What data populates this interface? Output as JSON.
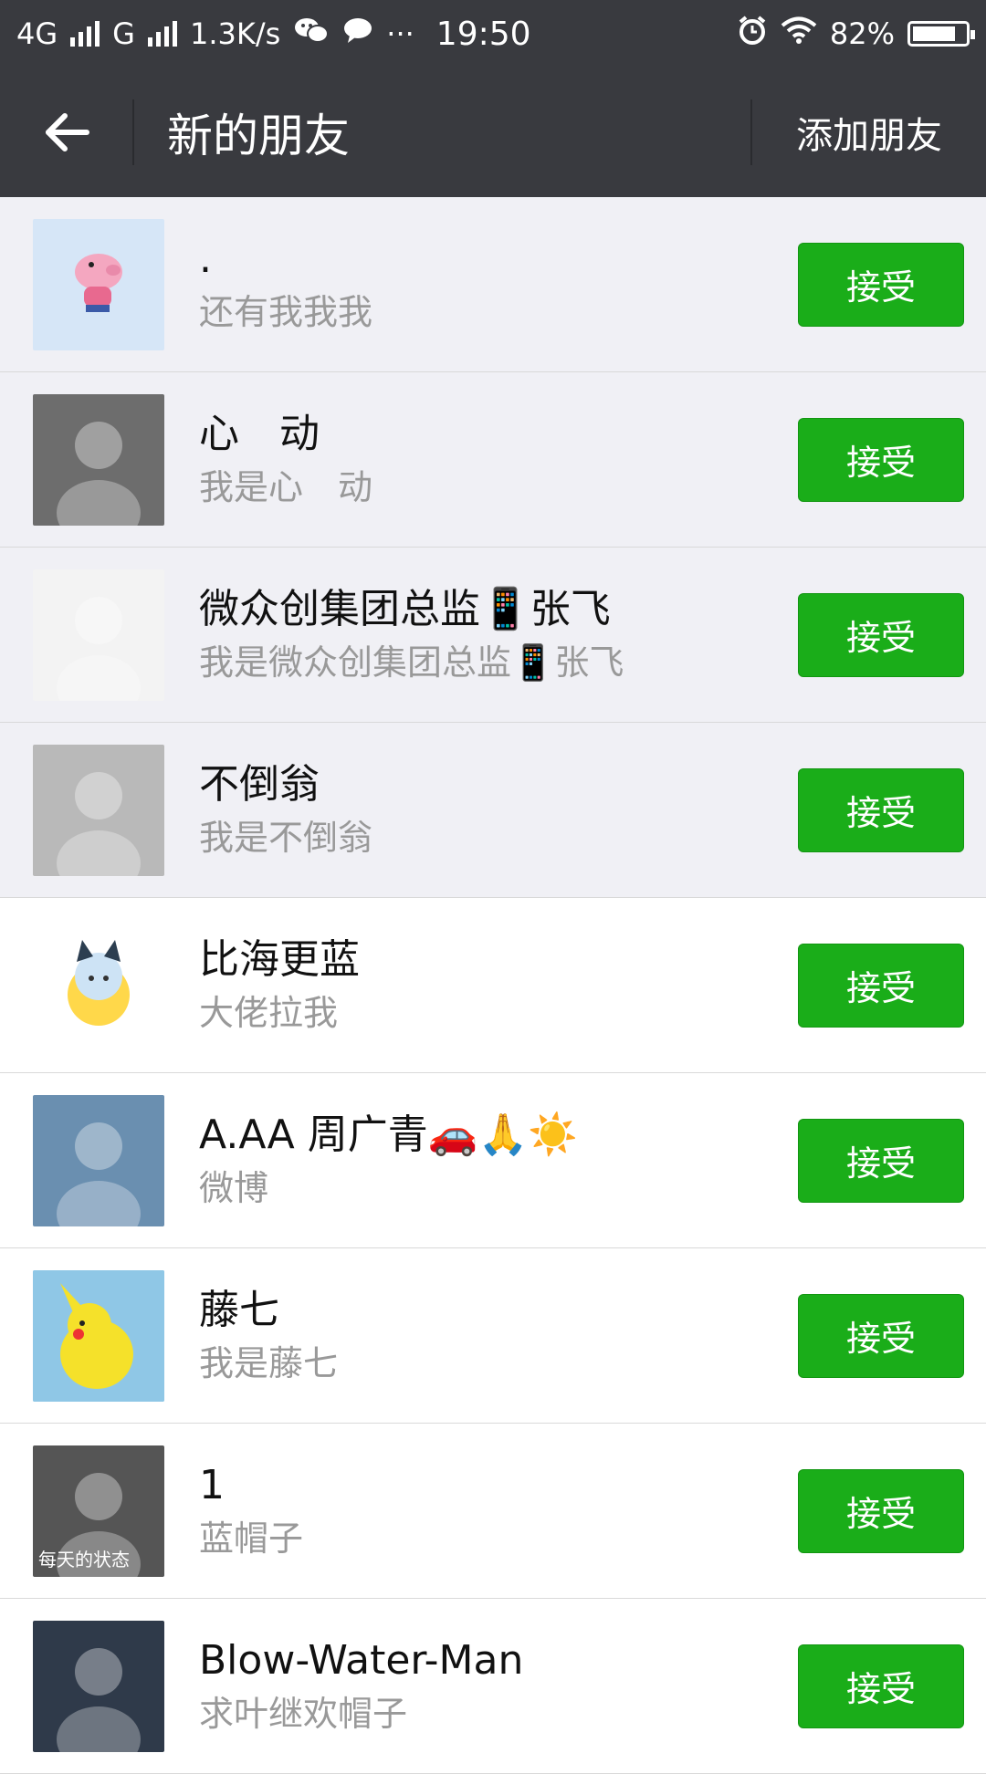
{
  "status_bar": {
    "network1": "4G",
    "network2": "G",
    "speed": "1.3K/s",
    "dots": "···",
    "time": "19:50",
    "battery_text": "82%",
    "battery_level": 0.82
  },
  "nav": {
    "title": "新的朋友",
    "add_friend_label": "添加朋友"
  },
  "requests": [
    {
      "name": ".",
      "message": "还有我我我",
      "accept_label": "接受",
      "avatar_color": "#d6e6f7",
      "avatar_icon": "pig-icon",
      "unread": true
    },
    {
      "name": "心　动",
      "message": "我是心　动",
      "accept_label": "接受",
      "avatar_color": "#6d6d6d",
      "avatar_icon": "person-photo",
      "unread": true
    },
    {
      "name": "微众创集团总监📱张飞",
      "message": "我是微众创集团总监📱张飞",
      "accept_label": "接受",
      "avatar_color": "#f3f3f3",
      "avatar_icon": "person-photo",
      "unread": true
    },
    {
      "name": "不倒翁",
      "message": "我是不倒翁",
      "accept_label": "接受",
      "avatar_color": "#b9b9b9",
      "avatar_icon": "rabbit-photo",
      "unread": true
    },
    {
      "name": "比海更蓝",
      "message": "大佬拉我",
      "accept_label": "接受",
      "avatar_color": "#ffffff",
      "avatar_icon": "cartoon-cat-icon",
      "unread": false
    },
    {
      "name": "A.AA 周广青🚗🙏☀️",
      "message": "微博",
      "accept_label": "接受",
      "avatar_color": "#6a8fb0",
      "avatar_icon": "baby-photo",
      "unread": false
    },
    {
      "name": "藤七",
      "message": "我是藤七",
      "accept_label": "接受",
      "avatar_color": "#8fc7e6",
      "avatar_icon": "pikachu-icon",
      "unread": false
    },
    {
      "name": "1",
      "message": "蓝帽子",
      "accept_label": "接受",
      "avatar_color": "#555555",
      "avatar_icon": "meme-photo",
      "avatar_caption": "每天的状态",
      "unread": false
    },
    {
      "name": "Blow-Water-Man",
      "message": "求叶继欢帽子",
      "accept_label": "接受",
      "avatar_color": "#2f3a4a",
      "avatar_icon": "statue-photo",
      "unread": false
    }
  ],
  "colors": {
    "bar": "#393a3f",
    "accept": "#1aad19",
    "unread_bg": "#f0f0f5"
  }
}
